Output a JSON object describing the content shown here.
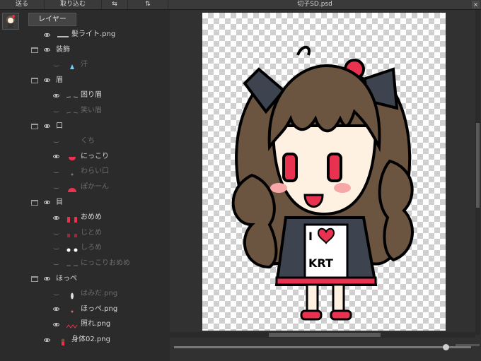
{
  "toolbar": {
    "send": "送る",
    "import": "取り込む",
    "swap_h": "⇆",
    "swap_v": "⇅",
    "file_title": "切子SD.psd",
    "close": "×"
  },
  "panel": {
    "tab": "レイヤー"
  },
  "layers": [
    {
      "label": "髪ライト.png",
      "visible": true,
      "folder": false
    },
    {
      "label": "装飾",
      "visible": true,
      "folder": true
    },
    {
      "label": "汗",
      "visible": false,
      "folder": false
    },
    {
      "label": "眉",
      "visible": true,
      "folder": true
    },
    {
      "label": "困り眉",
      "visible": true,
      "folder": false
    },
    {
      "label": "笑い眉",
      "visible": false,
      "folder": false
    },
    {
      "label": "口",
      "visible": true,
      "folder": true
    },
    {
      "label": "くち",
      "visible": false,
      "folder": false
    },
    {
      "label": "にっこり",
      "visible": true,
      "folder": false
    },
    {
      "label": "わらい口",
      "visible": false,
      "folder": false
    },
    {
      "label": "ぽかーん",
      "visible": false,
      "folder": false
    },
    {
      "label": "目",
      "visible": true,
      "folder": true
    },
    {
      "label": "おめめ",
      "visible": true,
      "folder": false
    },
    {
      "label": "じとめ",
      "visible": false,
      "folder": false
    },
    {
      "label": "しろめ",
      "visible": false,
      "folder": false
    },
    {
      "label": "にっこりおめめ",
      "visible": false,
      "folder": false
    },
    {
      "label": "ほっぺ",
      "visible": true,
      "folder": true
    },
    {
      "label": "はみだ.png",
      "visible": false,
      "folder": false
    },
    {
      "label": "ほっぺ.png",
      "visible": true,
      "folder": false
    },
    {
      "label": "照れ.png",
      "visible": true,
      "folder": false
    },
    {
      "label": "身体02.png",
      "visible": true,
      "folder": false
    }
  ],
  "artwork": {
    "shirt_text_1": "I",
    "shirt_text_2": "KRT"
  },
  "colors": {
    "hair": "#6b5440",
    "bow": "#3d4450",
    "accent": "#e8324f",
    "skin": "#fff1e2"
  }
}
